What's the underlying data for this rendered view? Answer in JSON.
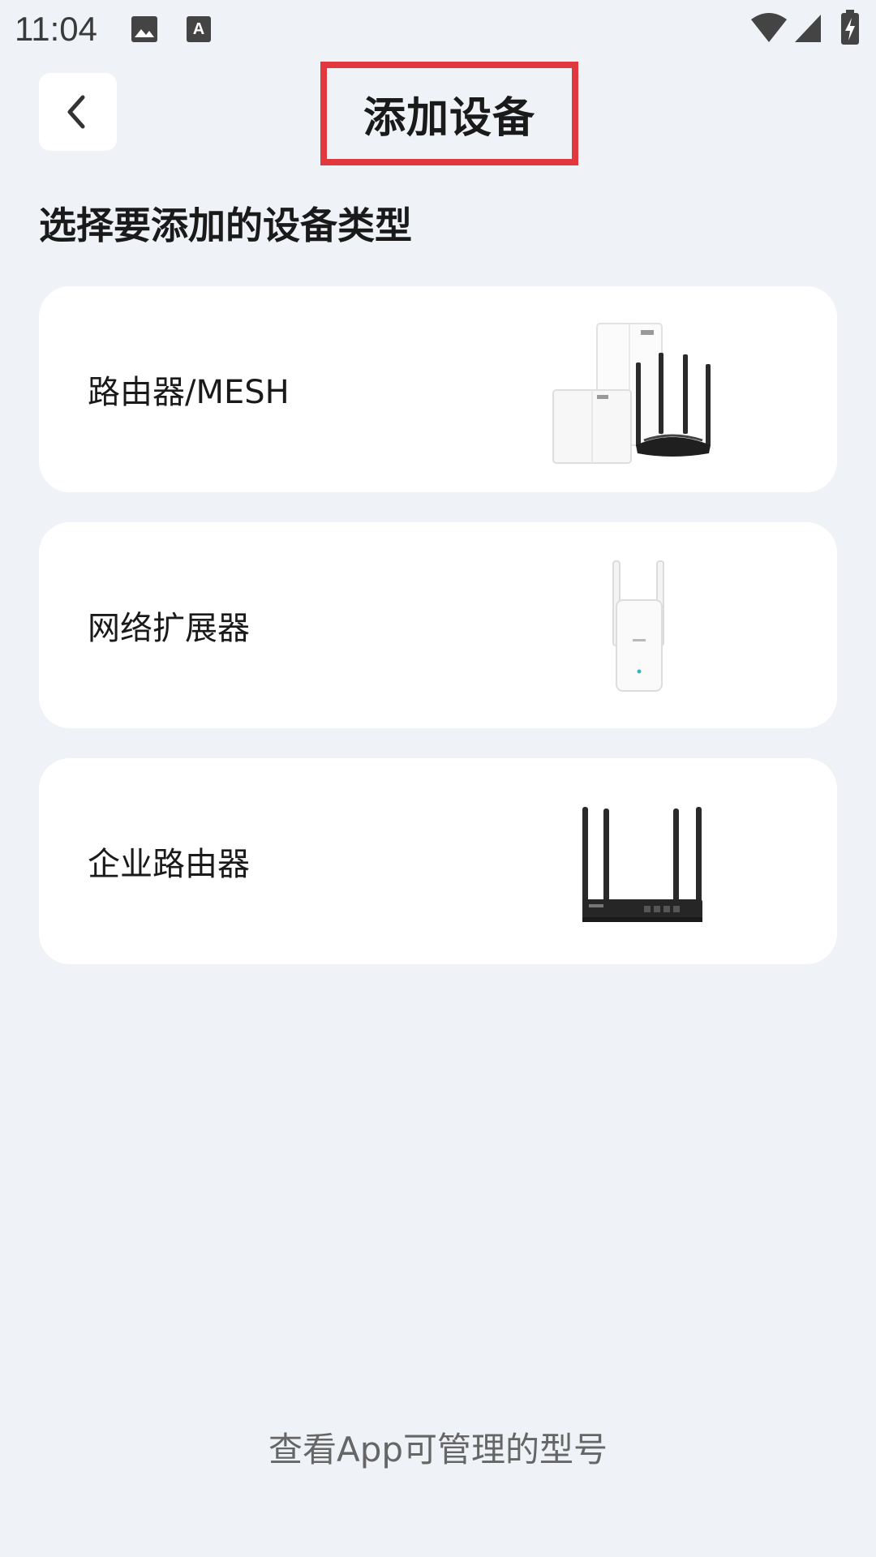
{
  "status_bar": {
    "time": "11:04",
    "icons": [
      "gallery-icon",
      "a-icon",
      "wifi-icon",
      "signal-icon",
      "battery-charging-icon"
    ]
  },
  "header": {
    "back_icon": "chevron-left-icon",
    "title": "添加设备",
    "title_highlight_color": "#e0383e"
  },
  "main": {
    "section_heading": "选择要添加的设备类型",
    "device_types": [
      {
        "label": "路由器/MESH",
        "image": "router-mesh-image"
      },
      {
        "label": "网络扩展器",
        "image": "range-extender-image"
      },
      {
        "label": "企业路由器",
        "image": "enterprise-router-image"
      }
    ]
  },
  "footer": {
    "link_text": "查看App可管理的型号"
  },
  "colors": {
    "background": "#eff3f7",
    "card": "#ffffff",
    "text_primary": "#1a1a1a",
    "text_secondary": "#666666"
  }
}
